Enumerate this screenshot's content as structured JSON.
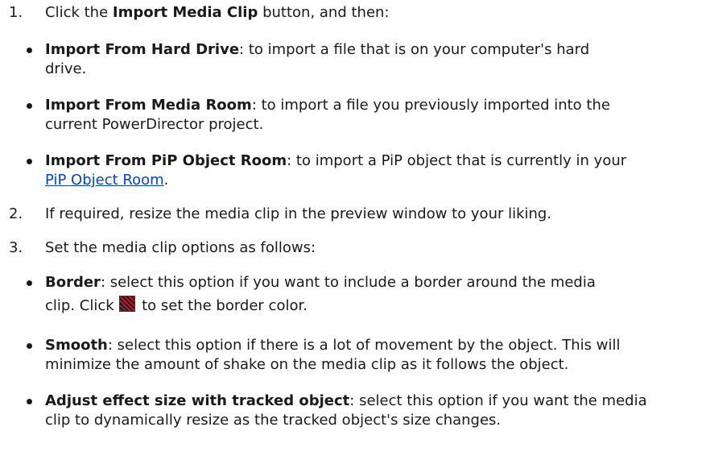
{
  "steps": [
    {
      "number": "1.",
      "pre": "Click the ",
      "bold": "Import Media Clip",
      "post": " button, and then:"
    },
    {
      "number": "2.",
      "text": "If required, resize the media clip in the preview window to your liking."
    },
    {
      "number": "3.",
      "text": "Set the media clip options as follows:"
    }
  ],
  "import_options": [
    {
      "bold": "Import From Hard Drive",
      "lines": [
        ": to import a file that is on your computer's hard",
        "drive."
      ]
    },
    {
      "bold": "Import From Media Room",
      "lines": [
        ": to import a file you previously imported into the",
        "current PowerDirector project."
      ]
    },
    {
      "bold": "Import From PiP Object Room",
      "lines": [
        ": to import a PiP object that is currently in your"
      ],
      "link": "PiP Object Room",
      "link_after": "."
    }
  ],
  "clip_options": [
    {
      "bold": "Border",
      "lines": [
        ": select this option if you want to include a border around the media"
      ],
      "line2_pre": "clip. Click ",
      "line2_post": " to set the border color.",
      "icon": "border-color-swatch-icon"
    },
    {
      "bold": "Smooth",
      "lines": [
        ": select this option if there is a lot of movement by the object. This will",
        "minimize the amount of shake on the media clip as it follows the object."
      ]
    },
    {
      "bold": "Adjust effect size with tracked object",
      "lines": [
        ": select this option if you want the media",
        "clip to dynamically resize as the tracked object's size changes."
      ]
    }
  ],
  "colors": {
    "text": "#1a1a1a",
    "link": "#0645c8",
    "swatch_a": "#c21a2a",
    "swatch_b": "#1a1a1a"
  }
}
